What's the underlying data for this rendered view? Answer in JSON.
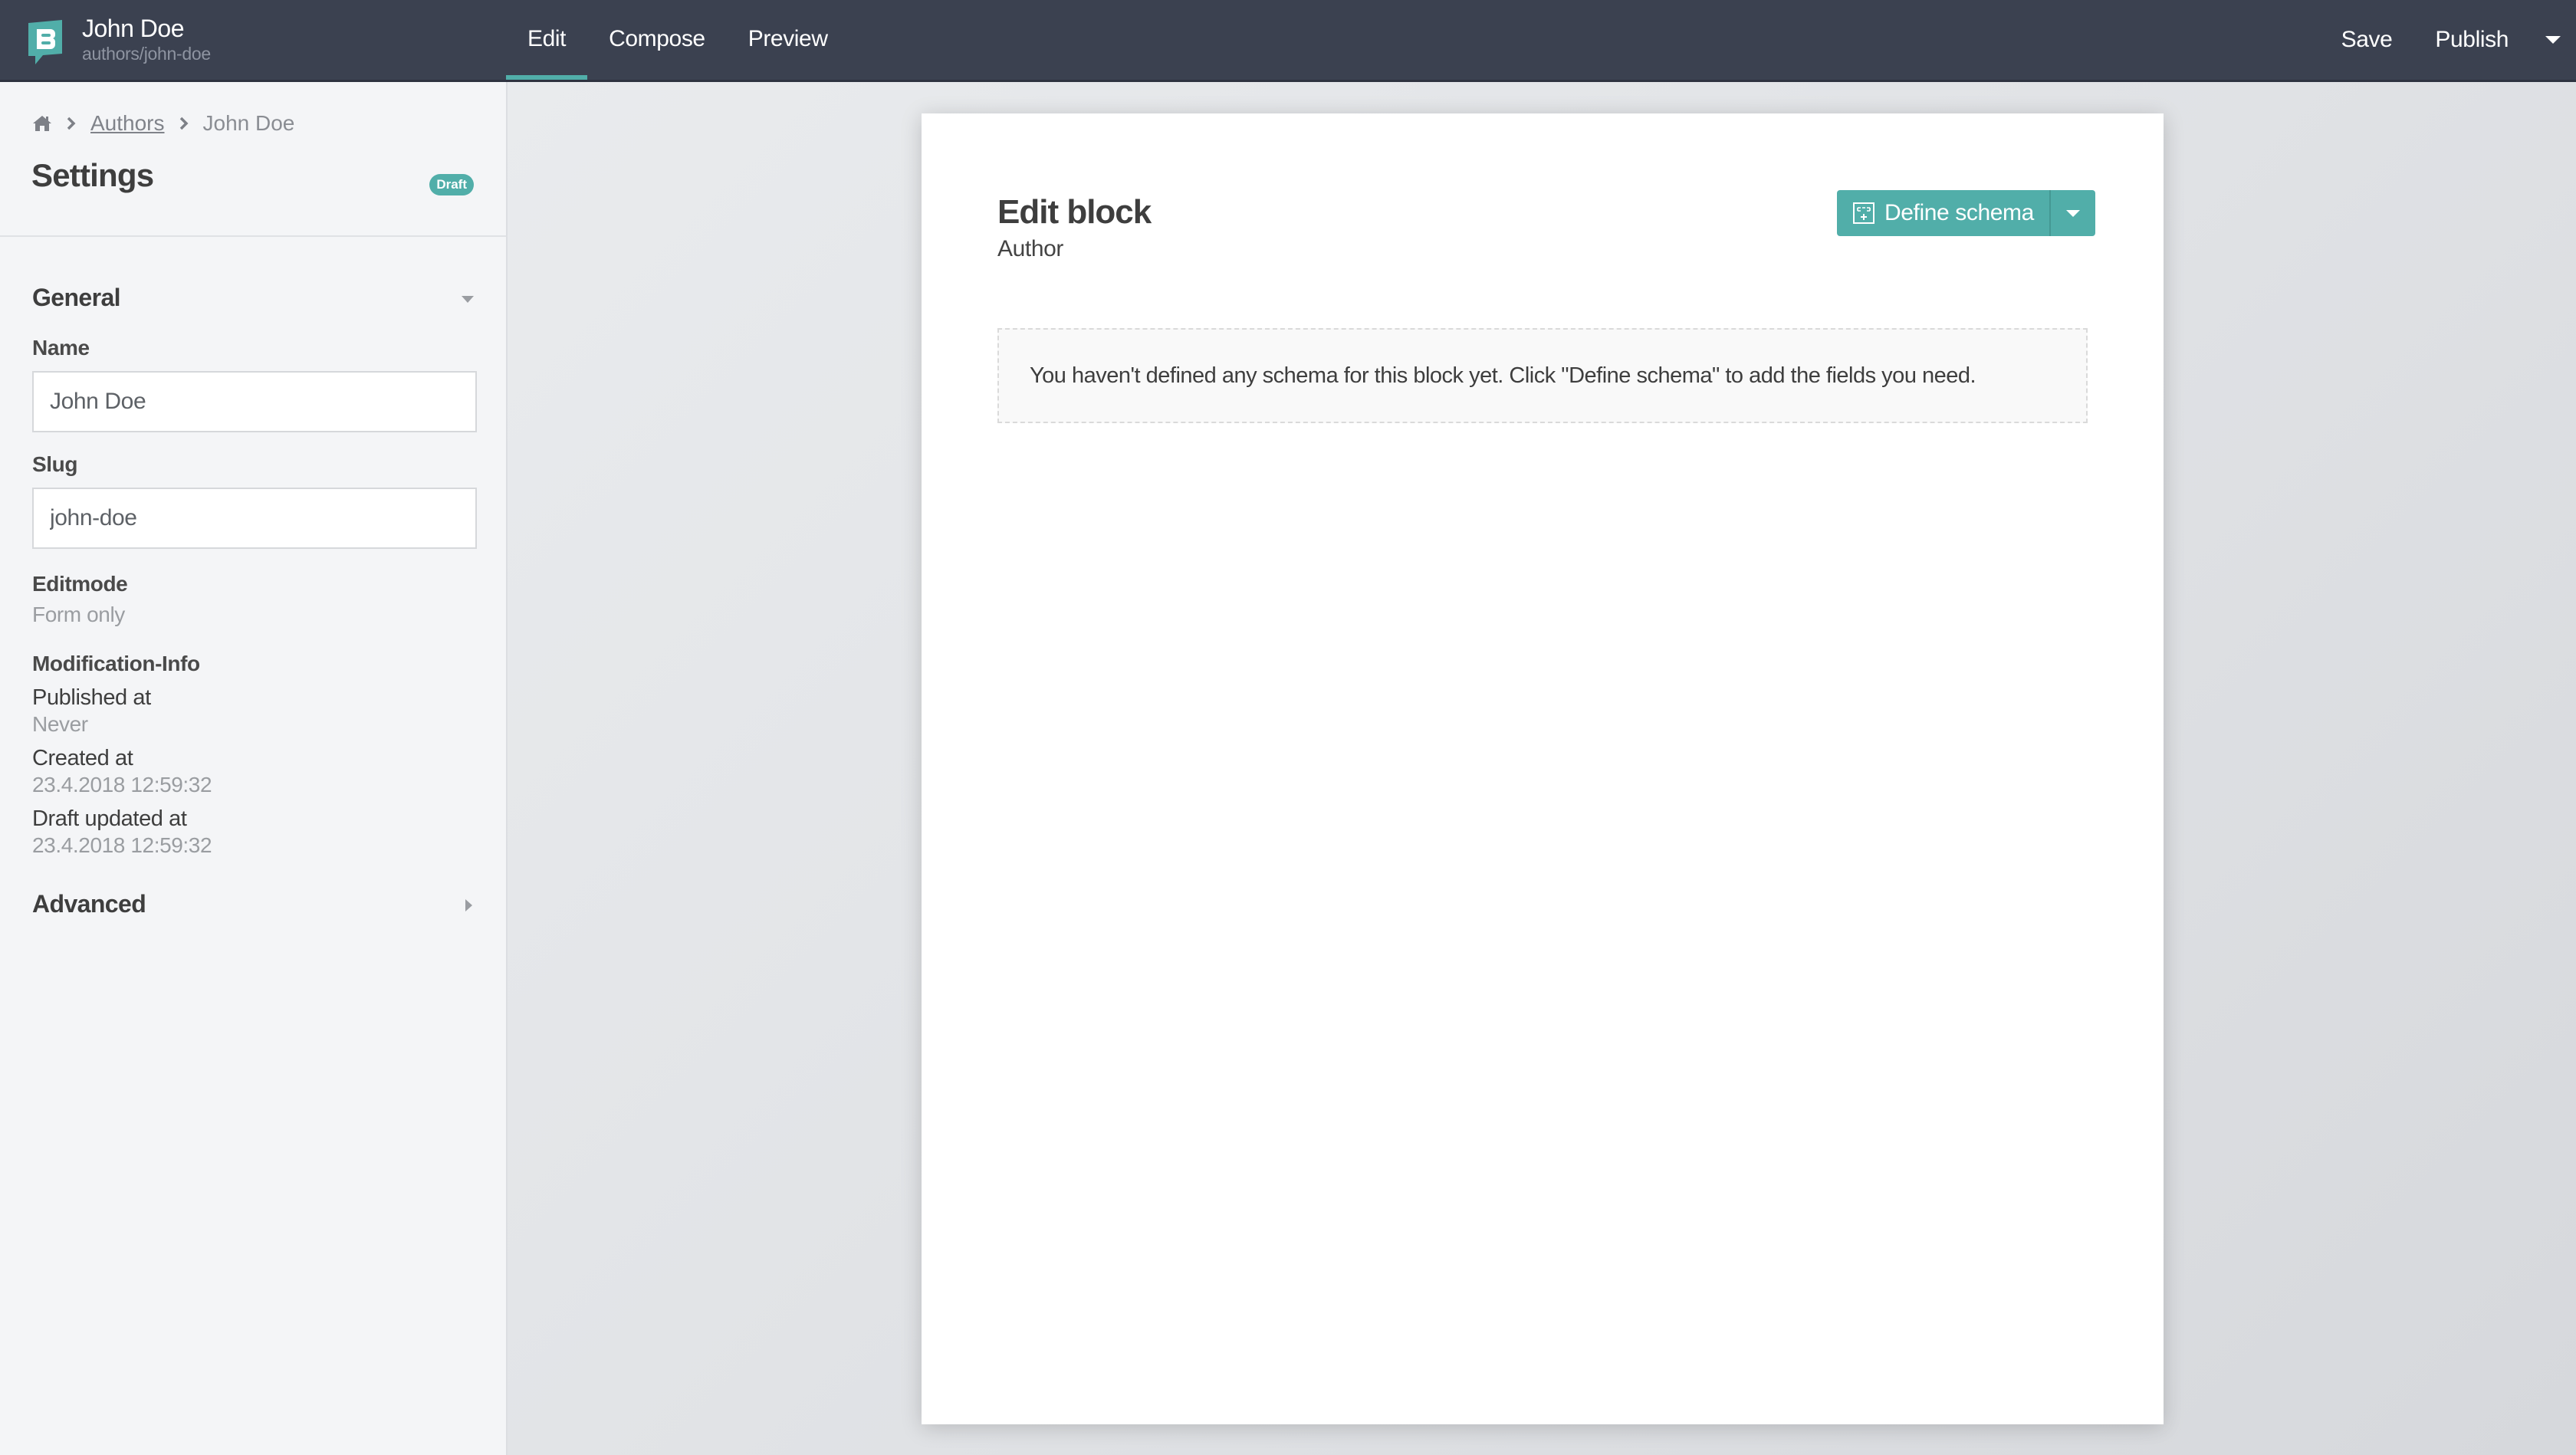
{
  "navbar": {
    "title": "John Doe",
    "subtitle": "authors/john-doe",
    "logo_icon": "storyblok-logo-icon",
    "tabs": [
      {
        "label": "Edit",
        "active": true
      },
      {
        "label": "Compose",
        "active": false
      },
      {
        "label": "Preview",
        "active": false
      }
    ],
    "save_label": "Save",
    "publish_label": "Publish",
    "publish_menu_icon": "caret-down-icon"
  },
  "sidebar": {
    "breadcrumb": {
      "home_icon": "home-icon",
      "items": [
        {
          "label": "Authors",
          "link": true
        },
        {
          "label": "John Doe",
          "link": false
        }
      ]
    },
    "title": "Settings",
    "status_badge": "Draft",
    "general": {
      "label": "General",
      "expanded": true,
      "name_label": "Name",
      "name_value": "John Doe",
      "slug_label": "Slug",
      "slug_value": "john-doe",
      "editmode_label": "Editmode",
      "editmode_value": "Form only",
      "modinfo_label": "Modification-Info",
      "published_label": "Published at",
      "published_value": "Never",
      "created_label": "Created at",
      "created_value": "23.4.2018 12:59:32",
      "draft_updated_label": "Draft updated at",
      "draft_updated_value": "23.4.2018 12:59:32"
    },
    "advanced": {
      "label": "Advanced",
      "expanded": false
    }
  },
  "main": {
    "title": "Edit block",
    "subtitle": "Author",
    "define_schema_label": "Define schema",
    "define_schema_icon": "schema-icon",
    "empty_message": "You haven't defined any schema for this block yet. Click \"Define schema\" to add the fields you need."
  },
  "colors": {
    "navbar_bg": "#3b4150",
    "accent": "#51aea9",
    "sidebar_bg": "#f4f5f7"
  }
}
